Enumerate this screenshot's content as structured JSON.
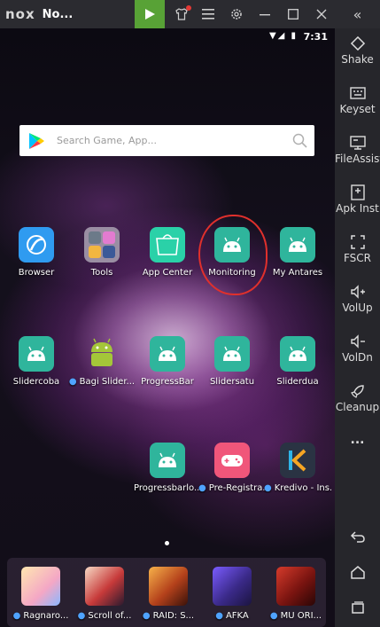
{
  "titlebar": {
    "logo": "nox",
    "title": "No...",
    "buttons": [
      "play-store-icon",
      "shirt-icon",
      "menu-icon",
      "gear-icon",
      "minimize-icon",
      "maximize-icon",
      "close-icon"
    ]
  },
  "statusbar": {
    "time": "7:31",
    "icons": "▼◢ ▮"
  },
  "search": {
    "placeholder": "Search Game, App..."
  },
  "home": {
    "row1": [
      {
        "label": "Browser",
        "icon": "browser-icon"
      },
      {
        "label": "Tools",
        "icon": "tools-folder-icon"
      },
      {
        "label": "App Center",
        "icon": "app-center-icon"
      },
      {
        "label": "Monitoring",
        "icon": "android-icon"
      },
      {
        "label": "My Antares",
        "icon": "android-icon"
      }
    ],
    "row2": [
      {
        "label": "Slidercoba",
        "icon": "android-icon"
      },
      {
        "label": "Bagi Slider...",
        "icon": "android-green-icon",
        "dot": true
      },
      {
        "label": "ProgressBar",
        "icon": "android-icon"
      },
      {
        "label": "Slidersatu",
        "icon": "android-icon"
      },
      {
        "label": "Sliderdua",
        "icon": "android-icon"
      }
    ],
    "row3": [
      {
        "label": "Progressbarlo...",
        "icon": "android-icon"
      },
      {
        "label": "Pre-Registra...",
        "icon": "gamepad-icon",
        "dot": true
      },
      {
        "label": "Kredivo - Ins...",
        "icon": "kredivo-icon",
        "dot": true
      }
    ]
  },
  "dock": [
    {
      "label": "Ragnaro...",
      "icon": "ragnarok-icon",
      "dot": true
    },
    {
      "label": "Scroll of...",
      "icon": "scroll-of-onmyoji-icon",
      "dot": true
    },
    {
      "label": "RAID: S...",
      "icon": "raid-icon",
      "dot": true
    },
    {
      "label": "AFKA",
      "icon": "afk-arena-icon",
      "dot": true
    },
    {
      "label": "MU ORI...",
      "icon": "mu-origin-icon",
      "dot": true
    }
  ],
  "sidebar": {
    "top": "«",
    "items": [
      {
        "label": "Shake",
        "icon": "shake-icon"
      },
      {
        "label": "Keyset",
        "icon": "keyboard-icon"
      },
      {
        "label": "FileAssist",
        "icon": "file-assist-icon"
      },
      {
        "label": "Apk Inst",
        "icon": "apk-install-icon"
      },
      {
        "label": "FSCR",
        "icon": "fullscreen-icon"
      },
      {
        "label": "VolUp",
        "icon": "volume-up-icon"
      },
      {
        "label": "VolDn",
        "icon": "volume-down-icon"
      },
      {
        "label": "Cleanup",
        "icon": "rocket-icon"
      },
      {
        "label": "...",
        "icon": "more-icon"
      }
    ],
    "nav": [
      "back-icon",
      "home-icon",
      "recents-icon"
    ]
  },
  "colors": {
    "accent_green": "#58a236",
    "teal_icon": "#2fb59c",
    "annotation_red": "#e0302c"
  }
}
